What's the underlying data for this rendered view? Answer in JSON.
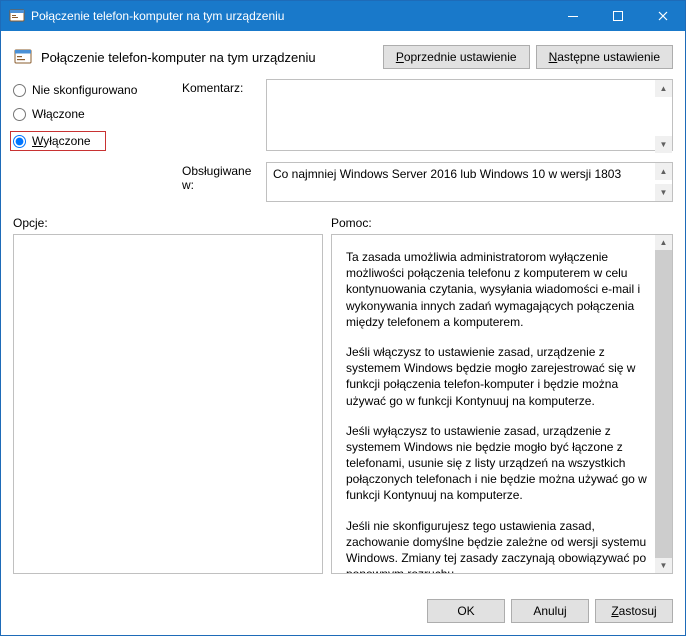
{
  "window": {
    "title": "Połączenie telefon-komputer na tym urządzeniu"
  },
  "page": {
    "title": "Połączenie telefon-komputer na tym urządzeniu"
  },
  "nav": {
    "prev": "Poprzednie ustawienie",
    "prev_underline_char": "P",
    "next": "Następne ustawienie",
    "next_underline_char": "N"
  },
  "radios": {
    "not_configured": "Nie skonfigurowano",
    "enabled": "Włączone",
    "disabled": "Wyłączone",
    "disabled_underline_char": "W",
    "selected": "disabled"
  },
  "labels": {
    "comment": "Komentarz:",
    "supported": "Obsługiwane w:",
    "options": "Opcje:",
    "help": "Pomoc:"
  },
  "fields": {
    "comment": "",
    "supported": "Co najmniej Windows Server 2016 lub Windows 10 w wersji 1803"
  },
  "help": {
    "p1": "Ta zasada umożliwia administratorom wyłączenie możliwości połączenia telefonu z komputerem w celu kontynuowania czytania, wysyłania wiadomości e-mail i wykonywania innych zadań wymagających połączenia między telefonem a komputerem.",
    "p2": "Jeśli włączysz to ustawienie zasad, urządzenie z systemem Windows będzie mogło zarejestrować się w funkcji połączenia telefon-komputer i będzie można używać go w funkcji Kontynuuj na komputerze.",
    "p3": "Jeśli wyłączysz to ustawienie zasad, urządzenie z systemem Windows nie będzie mogło być łączone z telefonami, usunie się z listy urządzeń na wszystkich połączonych telefonach i nie będzie można używać go w funkcji Kontynuuj na komputerze.",
    "p4": "Jeśli nie skonfigurujesz tego ustawienia zasad, zachowanie domyślne będzie zależne od wersji systemu Windows. Zmiany tej zasady zaczynają obowiązywać po ponownym rozruchu."
  },
  "footer": {
    "ok": "OK",
    "cancel": "Anuluj",
    "apply": "Zastosuj",
    "apply_underline_char": "Z"
  }
}
